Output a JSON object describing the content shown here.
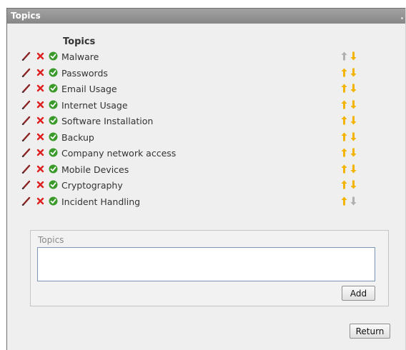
{
  "window": {
    "title": "Topics"
  },
  "list": {
    "heading": "Topics",
    "items": [
      {
        "label": "Malware",
        "up_enabled": false,
        "down_enabled": true
      },
      {
        "label": "Passwords",
        "up_enabled": true,
        "down_enabled": true
      },
      {
        "label": "Email Usage",
        "up_enabled": true,
        "down_enabled": true
      },
      {
        "label": "Internet Usage",
        "up_enabled": true,
        "down_enabled": true
      },
      {
        "label": "Software Installation",
        "up_enabled": true,
        "down_enabled": true
      },
      {
        "label": "Backup",
        "up_enabled": true,
        "down_enabled": true
      },
      {
        "label": "Company network access",
        "up_enabled": true,
        "down_enabled": true
      },
      {
        "label": "Mobile Devices",
        "up_enabled": true,
        "down_enabled": true
      },
      {
        "label": "Cryptography",
        "up_enabled": true,
        "down_enabled": true
      },
      {
        "label": "Incident Handling",
        "up_enabled": true,
        "down_enabled": false
      }
    ]
  },
  "add_panel": {
    "label": "Topics",
    "input_value": "",
    "add_label": "Add"
  },
  "footer": {
    "return_label": "Return"
  },
  "colors": {
    "edit": "#8b2323",
    "delete": "#e02020",
    "ok": "#3a9a2a",
    "arrow_enabled": "#f3b400",
    "arrow_disabled": "#b0b0b0"
  },
  "icons": {
    "edit": "pencil-icon",
    "delete": "delete-x-icon",
    "ok": "check-circle-icon",
    "up": "arrow-up-icon",
    "down": "arrow-down-icon"
  }
}
